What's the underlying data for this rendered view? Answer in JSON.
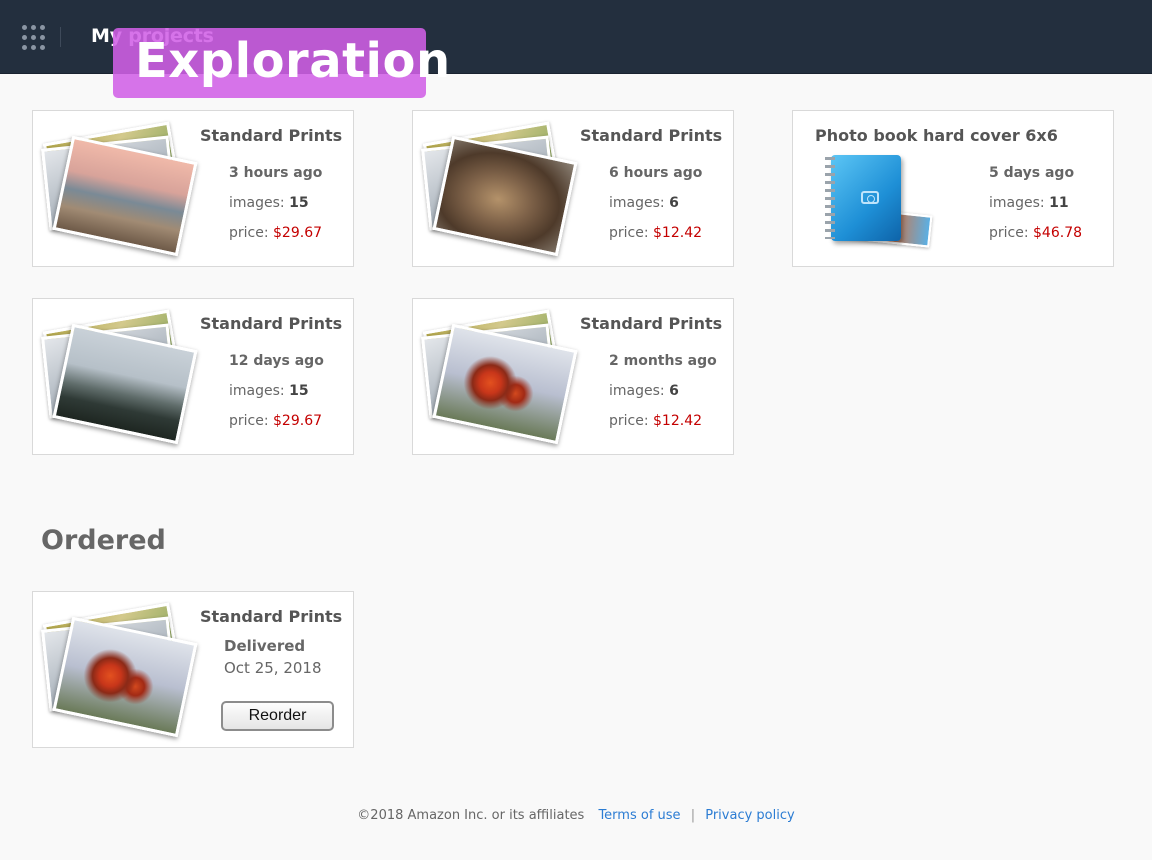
{
  "header": {
    "title": "My projects",
    "overlay_badge": "Exploration",
    "apps_icon": "apps-grid-icon"
  },
  "projects": [
    {
      "title": "Standard Prints",
      "time": "3 hours ago",
      "images_label": "images:",
      "images": "15",
      "price_label": "price:",
      "price": "$29.67",
      "thumbnail": "sunset-beach-photo"
    },
    {
      "title": "Standard Prints",
      "time": "6 hours ago",
      "images_label": "images:",
      "images": "6",
      "price_label": "price:",
      "price": "$12.42",
      "thumbnail": "cat-photo"
    },
    {
      "title": "Photo book hard cover 6x6",
      "time": "5 days ago",
      "images_label": "images:",
      "images": "11",
      "price_label": "price:",
      "price": "$46.78",
      "thumbnail": "photo-book-icon"
    },
    {
      "title": "Standard Prints",
      "time": "12 days ago",
      "images_label": "images:",
      "images": "15",
      "price_label": "price:",
      "price": "$29.67",
      "thumbnail": "foggy-forest-photo"
    },
    {
      "title": "Standard Prints",
      "time": "2 months ago",
      "images_label": "images:",
      "images": "6",
      "price_label": "price:",
      "price": "$12.42",
      "thumbnail": "orange-flower-photo"
    }
  ],
  "ordered": {
    "heading": "Ordered",
    "items": [
      {
        "title": "Standard Prints",
        "status": "Delivered",
        "date": "Oct 25, 2018",
        "button": "Reorder",
        "thumbnail": "orange-flower-photo"
      }
    ]
  },
  "footer": {
    "copyright": "©2018 Amazon Inc. or its affiliates",
    "terms": "Terms of use",
    "separator": "|",
    "privacy": "Privacy policy"
  },
  "colors": {
    "header_bg": "#232f3e",
    "price": "#c40000",
    "link": "#2b7cd3",
    "badge": "#d060e6"
  }
}
